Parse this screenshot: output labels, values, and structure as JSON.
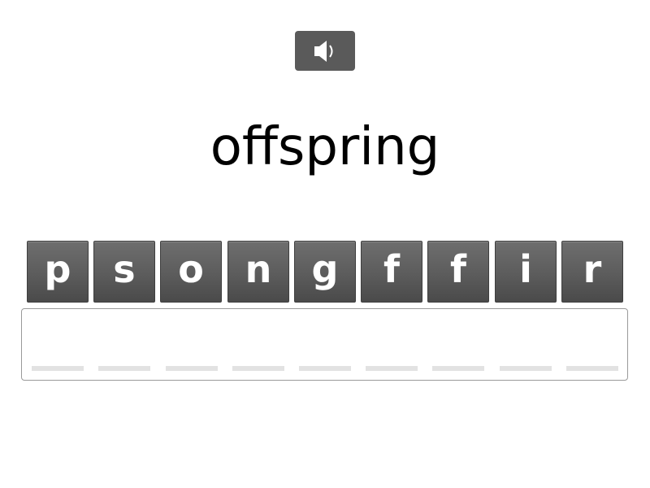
{
  "audio_button": {
    "icon": "speaker-icon"
  },
  "word": "offspring",
  "tiles": [
    "p",
    "s",
    "o",
    "n",
    "g",
    "f",
    "f",
    "i",
    "r"
  ],
  "answer_slots": [
    "",
    "",
    "",
    "",
    "",
    "",
    "",
    "",
    ""
  ],
  "colors": {
    "tile": "#5c5c5c",
    "tile_text": "#ffffff",
    "audio_button": "#5a5a5a",
    "slot": "#e2e2e2",
    "answer_border": "#9a9a9a"
  }
}
